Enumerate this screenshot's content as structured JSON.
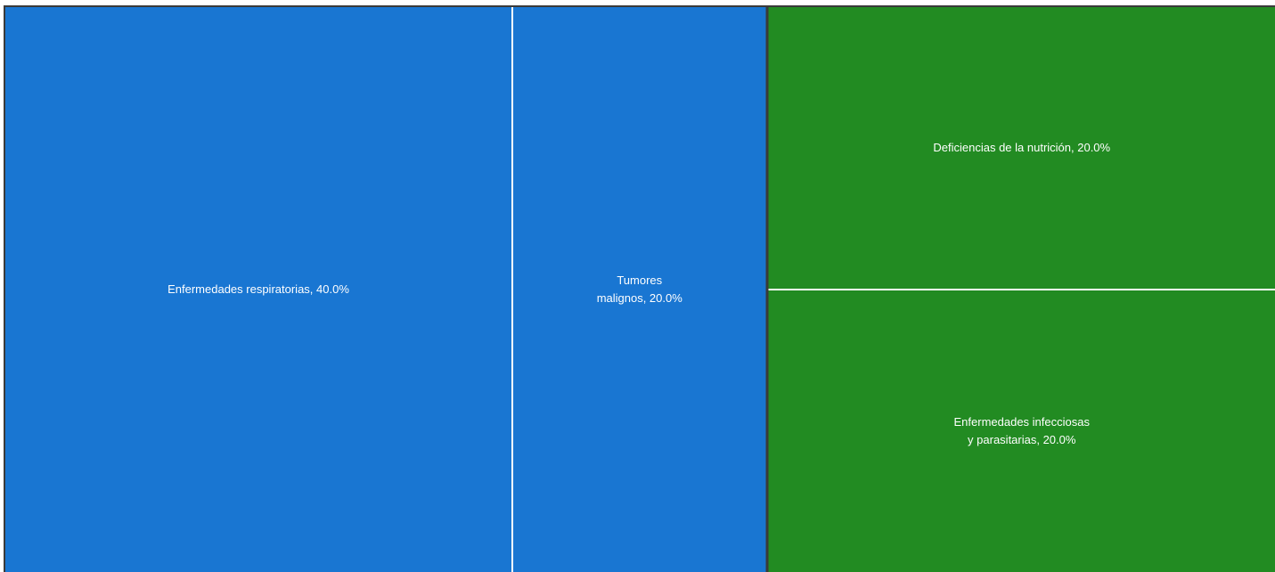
{
  "chart_data": {
    "type": "treemap",
    "title": "",
    "groups": [
      {
        "color": "#1976D2",
        "items": [
          {
            "label_lines": [
              "Enfermedades respiratorias, 40.0%"
            ],
            "value": 40.0
          },
          {
            "label_lines": [
              "Tumores",
              "malignos, 20.0%"
            ],
            "value": 20.0
          }
        ]
      },
      {
        "color": "#228B22",
        "items": [
          {
            "label_lines": [
              "Deficiencias de la nutrición, 20.0%"
            ],
            "value": 20.0
          },
          {
            "label_lines": [
              "Enfermedades infecciosas",
              "y parasitarias, 20.0%"
            ],
            "value": 20.0
          }
        ]
      }
    ]
  }
}
